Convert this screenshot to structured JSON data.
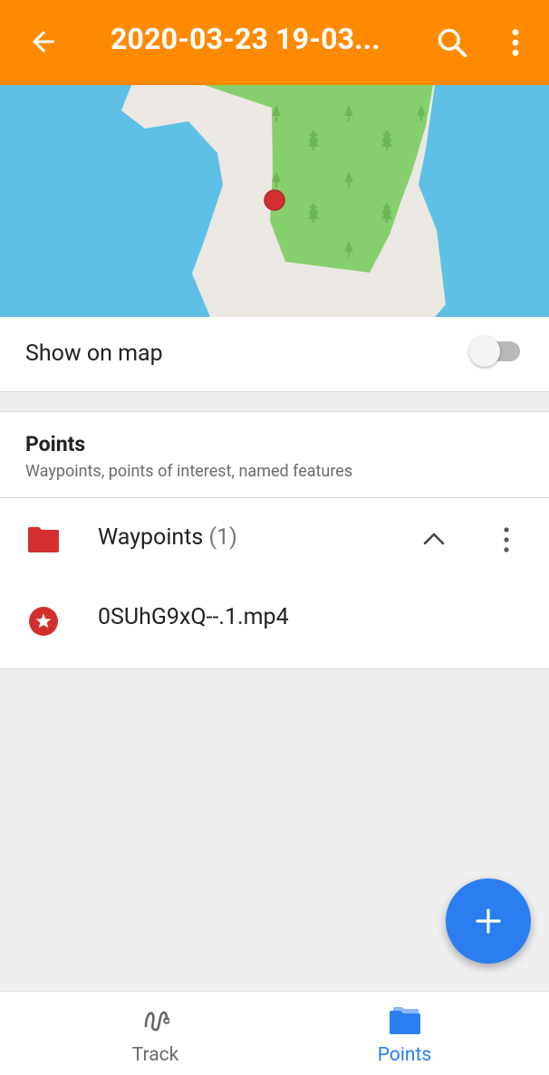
{
  "app_bar": {
    "title": "2020-03-23 19-03...",
    "back_icon": "arrow-back-icon",
    "search_icon": "search-icon",
    "more_icon": "more-vert-icon"
  },
  "map": {
    "colors": {
      "water": "#5ec0e5",
      "land": "#ebe8e3",
      "forest": "#86cf6e",
      "marker": "#d32f2f"
    }
  },
  "show_on_map": {
    "label": "Show on map",
    "enabled": false
  },
  "points_section": {
    "title": "Points",
    "subtitle": "Waypoints, points of interest, named features",
    "folder": {
      "name": "Waypoints",
      "count": "(1)",
      "icon": "folder-icon",
      "color": "#d32f2f",
      "expanded": true
    },
    "items": [
      {
        "name": "0SUhG9xQ--.1.mp4",
        "icon": "star-marker-icon"
      }
    ]
  },
  "fab": {
    "icon": "plus-icon",
    "color": "#2a7ef0"
  },
  "bottom_nav": {
    "tabs": [
      {
        "label": "Track",
        "icon": "track-route-icon",
        "active": false
      },
      {
        "label": "Points",
        "icon": "folder-icon",
        "active": true
      }
    ]
  },
  "colors": {
    "accent": "#ff8a00",
    "active_tab": "#2a7ef0"
  }
}
